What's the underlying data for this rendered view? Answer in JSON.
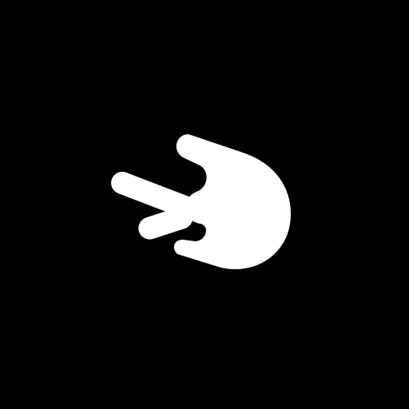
{
  "screen": {
    "background_color": "#000000",
    "logo": {
      "icon": "comet-logo-icon",
      "fill_color": "#FFFFFF"
    }
  }
}
